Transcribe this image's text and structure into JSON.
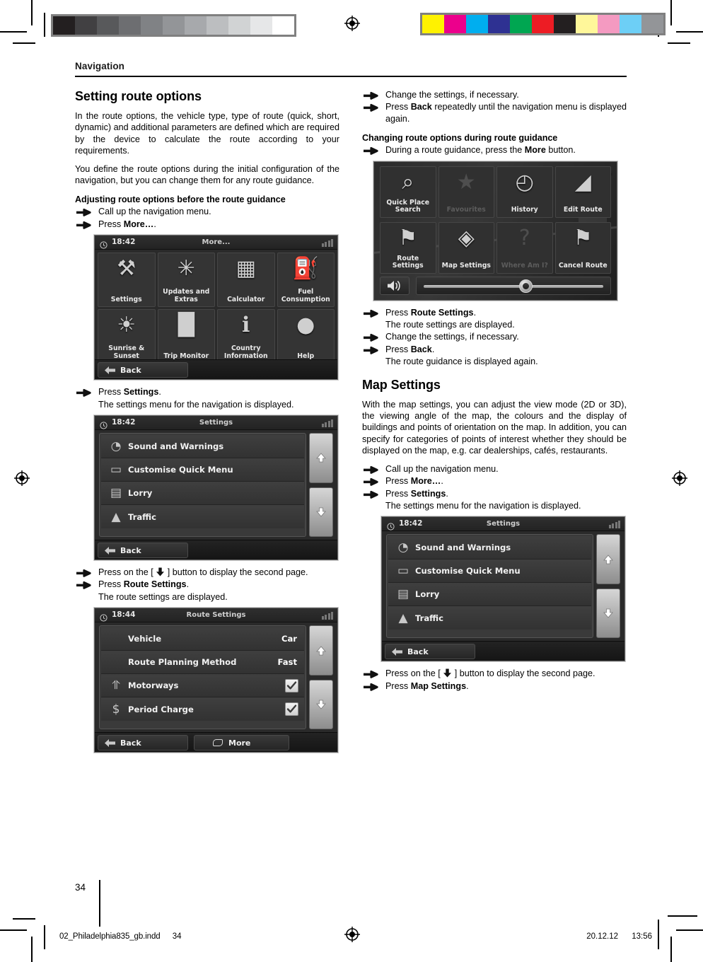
{
  "print_marks": {
    "grey_bar": [
      "#231f20",
      "#414042",
      "#58595b",
      "#6d6e71",
      "#808285",
      "#939598",
      "#a7a9ac",
      "#bcbec0",
      "#d1d3d4",
      "#e6e7e8",
      "#ffffff"
    ],
    "colour_bar": [
      "#fff200",
      "#ec008c",
      "#00aeef",
      "#2e3192",
      "#00a651",
      "#ed1c24",
      "#231f20",
      "#fff79a",
      "#f49ac1",
      "#6dcff6",
      "#939598"
    ]
  },
  "running_head": "Navigation",
  "left_column": {
    "section_title": "Setting route options",
    "paragraphs": [
      "In the route options, the vehicle type, type of route (quick, short, dynamic) and additional parameters are defined which are required by the device to calculate the route according to your requirements.",
      "You define the route options during the initial configuration of the navigation, but you can change them for any route guidance."
    ],
    "subheading": "Adjusting route options before the route guidance",
    "steps": [
      {
        "text": "Call up the navigation menu."
      },
      {
        "text": "Press More…."
      },
      {
        "text": "Press Settings."
      },
      {
        "text": "Press on the [ ↓ ] button to display the second page."
      },
      {
        "text": "Press Route Settings."
      }
    ],
    "notes": [
      "The settings menu for the navigation is displayed.",
      "The route settings are displayed."
    ]
  },
  "right_column": {
    "steps_top": [
      {
        "text": "Change the settings, if necessary."
      },
      {
        "text": "Press Back repeatedly until the navigation menu is displayed again."
      }
    ],
    "subheading": "Changing route options during route guidance",
    "step_more": "During a route guidance, press the More button.",
    "steps_after_menu": [
      {
        "text": "Press Route Settings."
      },
      {
        "text": "Change the settings, if necessary."
      },
      {
        "text": "Press Back."
      }
    ],
    "notes": [
      "The route settings are displayed.",
      "The route guidance is displayed again."
    ],
    "section_title": "Map Settings",
    "paragraph": "With the map settings, you can adjust the view mode (2D or 3D), the viewing angle of the map, the colours and the display of buildings and points of orientation on the map. In addition, you can specify for categories of points of interest whether they should be displayed on the map, e.g. car dealerships, cafés, restaurants.",
    "steps_map": [
      {
        "text": "Call up the navigation menu."
      },
      {
        "text": "Press More…."
      },
      {
        "text": "Press Settings."
      }
    ],
    "note_settings": "The settings menu for the navigation is displayed.",
    "steps_map_end": [
      {
        "text": "Press on the [ ↓ ] button to display the second page."
      },
      {
        "text": "Press Map Settings."
      }
    ]
  },
  "screens": {
    "more_menu": {
      "time": "18:42",
      "title": "More...",
      "tiles": [
        {
          "label": "Settings",
          "icon": "tools-icon",
          "glyph": "⚒",
          "dim": false
        },
        {
          "label": "Updates and Extras",
          "icon": "satellite-icon",
          "glyph": "✳",
          "dim": false
        },
        {
          "label": "Calculator",
          "icon": "calculator-icon",
          "glyph": "▦",
          "dim": false
        },
        {
          "label": "Fuel Consumption",
          "icon": "fuel-can-icon",
          "glyph": "⛽",
          "dim": false
        },
        {
          "label": "Sunrise & Sunset",
          "icon": "sun-clock-icon",
          "glyph": "☀",
          "dim": false
        },
        {
          "label": "Trip Monitor",
          "icon": "bar-chart-icon",
          "glyph": "█",
          "dim": false
        },
        {
          "label": "Country Information",
          "icon": "info-icon",
          "glyph": "ℹ",
          "dim": false
        },
        {
          "label": "Help",
          "icon": "lightbulb-icon",
          "glyph": "●",
          "dim": false
        }
      ],
      "back_label": "Back"
    },
    "settings_list_1": {
      "time": "18:42",
      "title": "Settings",
      "rows": [
        {
          "label": "Sound and Warnings",
          "icon": "speaker-icon",
          "glyph": "◔"
        },
        {
          "label": "Customise Quick Menu",
          "icon": "quick-menu-icon",
          "glyph": "▭"
        },
        {
          "label": "Lorry",
          "icon": "lorry-icon",
          "glyph": "▤"
        },
        {
          "label": "Traffic",
          "icon": "traffic-warning-icon",
          "glyph": "▲"
        }
      ],
      "back_label": "Back"
    },
    "route_settings": {
      "time": "18:44",
      "title": "Route Settings",
      "rows": [
        {
          "label": "Vehicle",
          "value": "Car",
          "icon": "",
          "glyph": "",
          "checked": false
        },
        {
          "label": "Route Planning Method",
          "value": "Fast",
          "icon": "",
          "glyph": "",
          "checked": false
        },
        {
          "label": "Motorways",
          "value": "",
          "icon": "motorway-icon",
          "glyph": "⥣",
          "checked": true
        },
        {
          "label": "Period Charge",
          "value": "",
          "icon": "toll-icon",
          "glyph": "$",
          "checked": true
        }
      ],
      "back_label": "Back",
      "more_label": "More"
    },
    "nav_menu": {
      "tiles": [
        {
          "label": "Quick Place Search",
          "icon": "magnifier-icon",
          "glyph": "⌕",
          "dim": false
        },
        {
          "label": "Favourites",
          "icon": "star-icon",
          "glyph": "★",
          "dim": true
        },
        {
          "label": "History",
          "icon": "clock-icon",
          "glyph": "◴",
          "dim": false
        },
        {
          "label": "Edit Route",
          "icon": "ruler-icon",
          "glyph": "◢",
          "dim": false
        },
        {
          "label": "Route Settings",
          "icon": "signpost-icon",
          "glyph": "⚑",
          "dim": false
        },
        {
          "label": "Map Settings",
          "icon": "map-eye-icon",
          "glyph": "◈",
          "dim": false
        },
        {
          "label": "Where Am I?",
          "icon": "question-map-icon",
          "glyph": "?",
          "dim": true
        },
        {
          "label": "Cancel Route",
          "icon": "checkered-flag-icon",
          "glyph": "⚑",
          "dim": false
        }
      ],
      "chevron": "»",
      "volume_icon": "speaker-volume-icon",
      "volume_percent": 53
    },
    "settings_list_2": {
      "time": "18:42",
      "title": "Settings",
      "rows": [
        {
          "label": "Sound and Warnings",
          "icon": "speaker-icon",
          "glyph": "◔"
        },
        {
          "label": "Customise Quick Menu",
          "icon": "quick-menu-icon",
          "glyph": "▭"
        },
        {
          "label": "Lorry",
          "icon": "lorry-icon",
          "glyph": "▤"
        },
        {
          "label": "Traffic",
          "icon": "traffic-warning-icon",
          "glyph": "▲"
        }
      ],
      "back_label": "Back"
    }
  },
  "folio": "34",
  "footer": {
    "filename": "02_Philadelphia835_gb.indd",
    "page": "34",
    "date": "20.12.12",
    "time": "13:56"
  }
}
